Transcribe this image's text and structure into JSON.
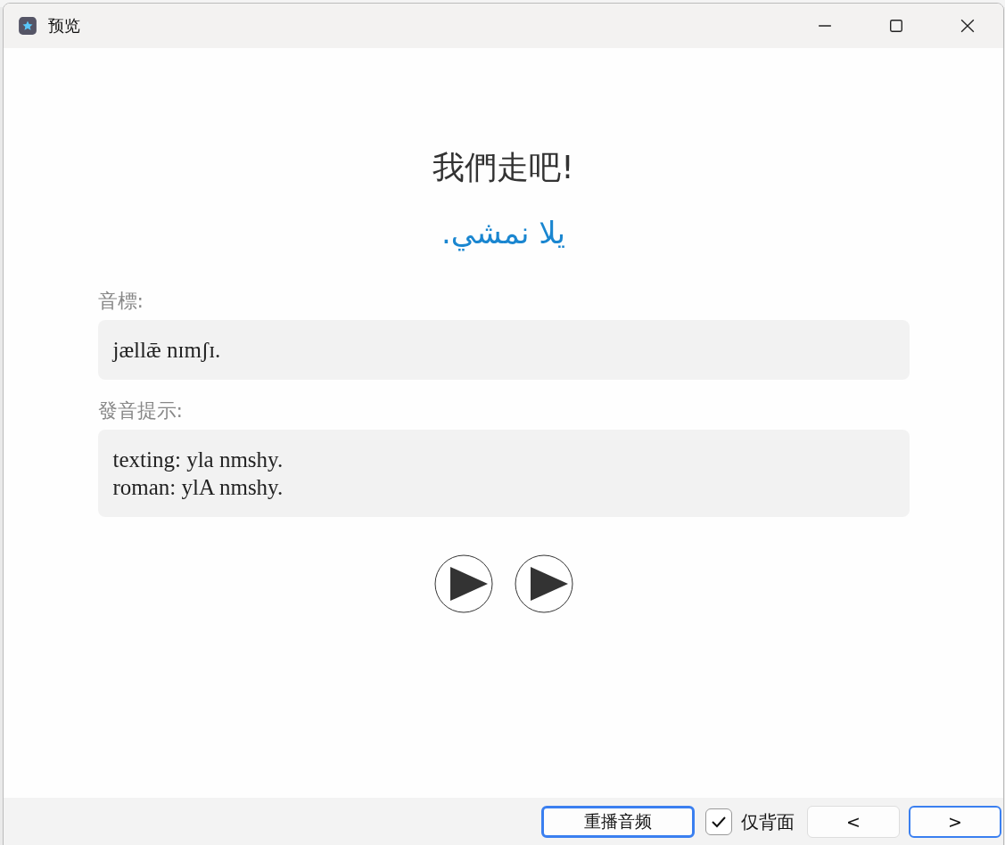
{
  "window": {
    "title": "预览"
  },
  "card": {
    "front": "我們走吧!",
    "back": "يلا نمشي.",
    "fields": [
      {
        "label": "音標:",
        "lines": [
          "jællǣ nɪmʃɪ."
        ]
      },
      {
        "label": "發音提示:",
        "lines": [
          "texting: yla nmshy.",
          "roman: ylA nmshy."
        ]
      }
    ],
    "audio_buttons": [
      {
        "kind": "play"
      },
      {
        "kind": "play"
      }
    ]
  },
  "footer": {
    "replay_button": "重播音频",
    "back_only": {
      "label": "仅背面",
      "checked": true
    },
    "prev_button": "<",
    "next_button": ">"
  }
}
